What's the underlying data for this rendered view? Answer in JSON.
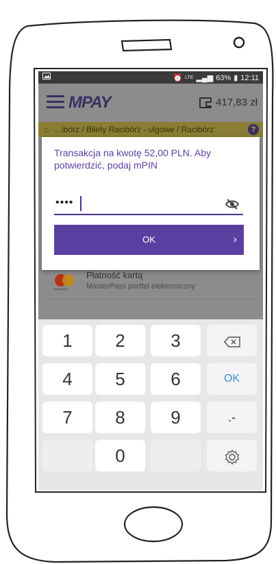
{
  "status_bar": {
    "network": "LTE",
    "battery": "63%",
    "time": "12:11"
  },
  "header": {
    "logo": "MPAY",
    "balance": "417,83 zł"
  },
  "breadcrumb": {
    "text": "...ibórz / Bilety Racibórz - ulgowe / Racibórz",
    "help": "?"
  },
  "payment_option": {
    "title": "Płatność kartą",
    "subtitle": "MasterPass portfel elektroniczny",
    "logo_text": "masterpass"
  },
  "dialog": {
    "message": "Transakcja na kwotę 52,00 PLN. Aby potwierdzić, podaj mPIN",
    "pin_value": "••••",
    "ok_label": "OK",
    "chevron": "›"
  },
  "keyboard": {
    "keys": [
      "1",
      "2",
      "3",
      "4",
      "5",
      "6",
      "7",
      "8",
      "9",
      "0"
    ],
    "ok_label": "OK",
    "symbols_label": ".-",
    "backspace_icon": "backspace-icon",
    "settings_icon": "settings-icon"
  },
  "colors": {
    "brand_purple": "#5b3fa0",
    "breadcrumb_yellow": "#c7b830",
    "keyboard_ok_blue": "#3b8fd0"
  }
}
